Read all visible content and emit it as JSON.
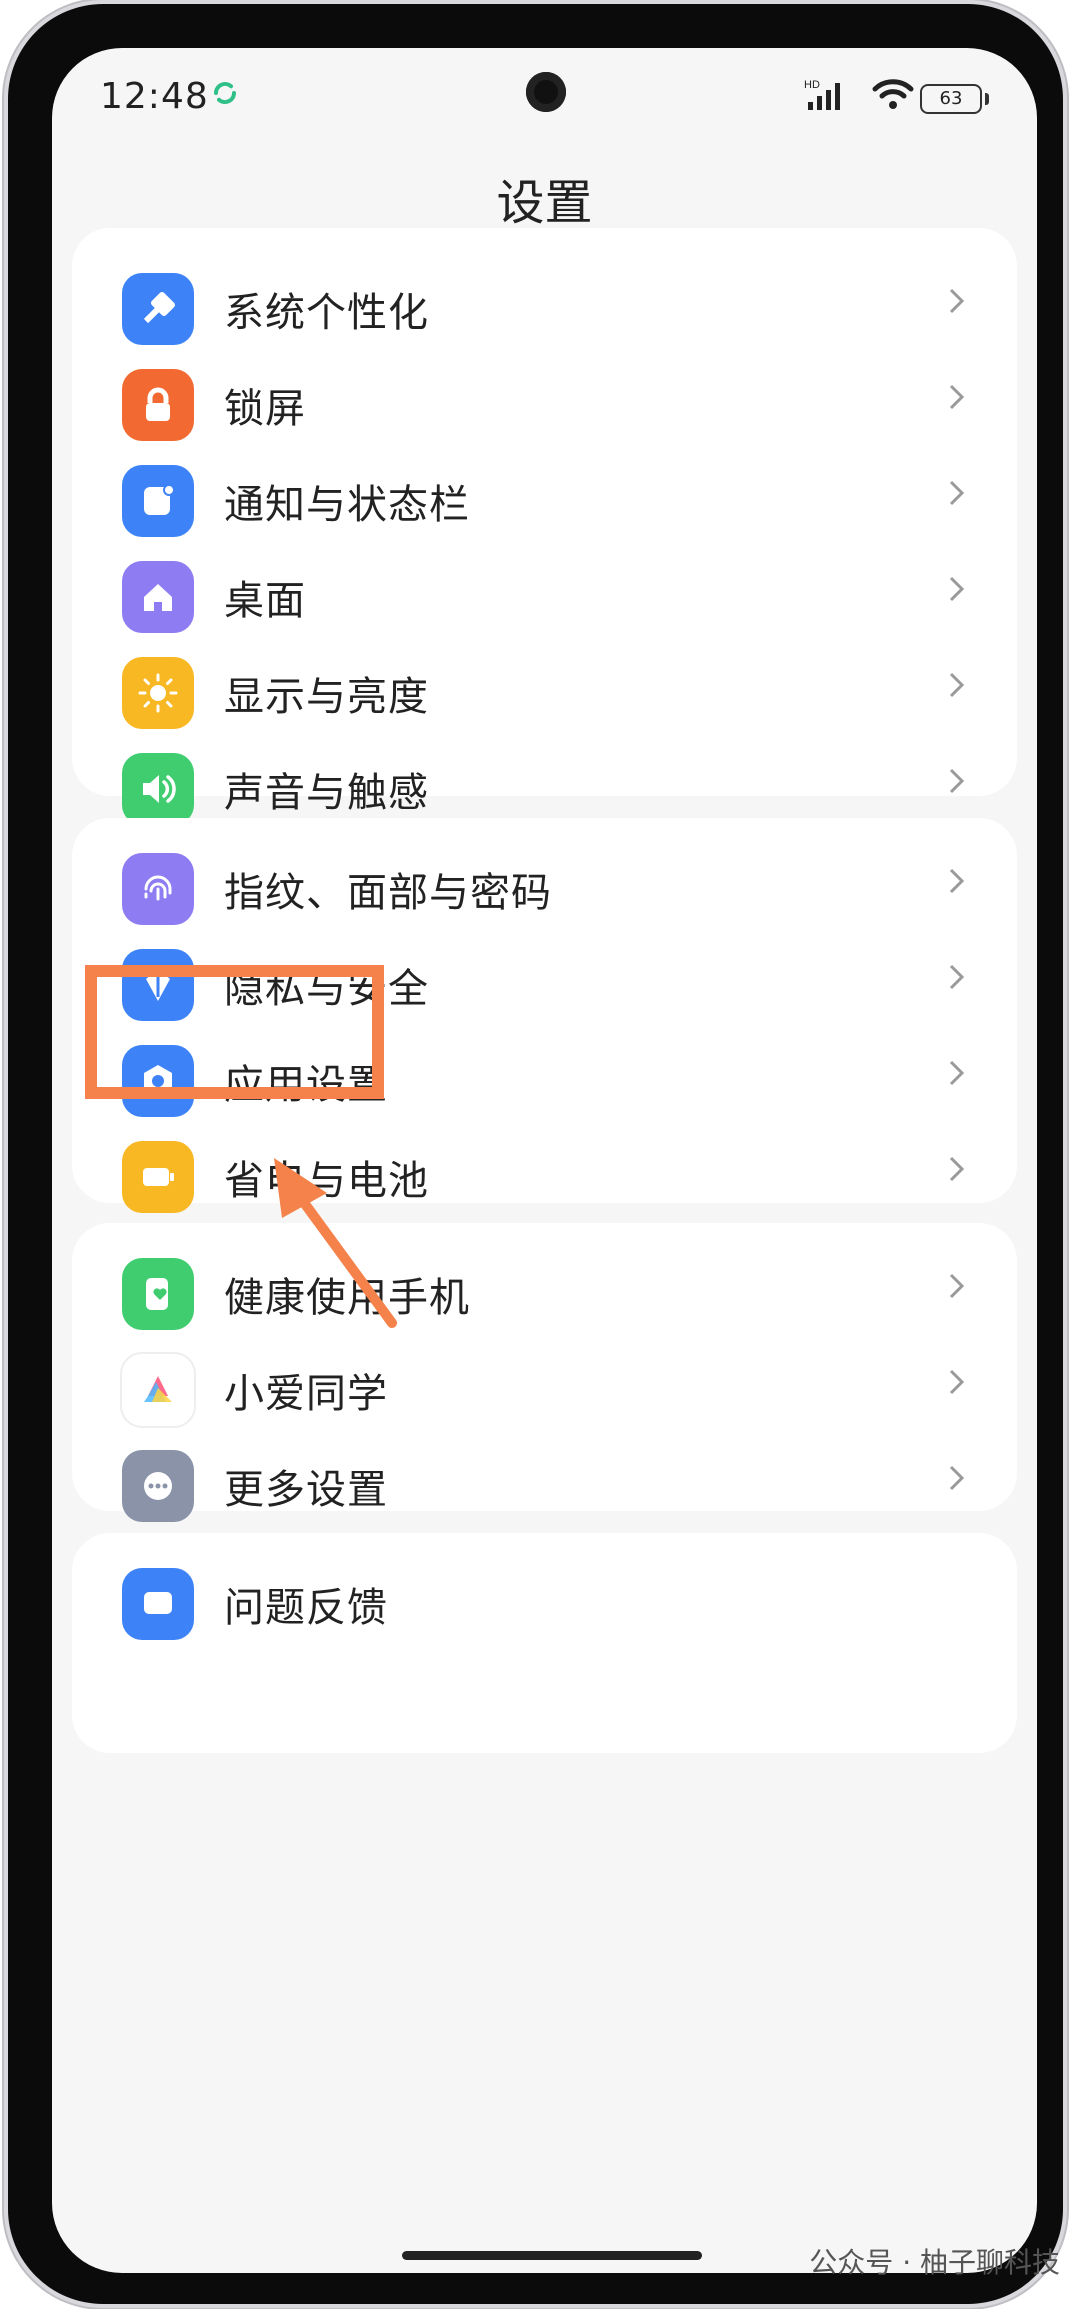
{
  "status": {
    "time": "12:48",
    "battery": "63",
    "network_badge": "HD"
  },
  "page": {
    "title": "设置"
  },
  "groups": [
    {
      "items": [
        {
          "label": "系统个性化",
          "icon": "brush-icon",
          "color": "#3d82f7"
        },
        {
          "label": "锁屏",
          "icon": "lock-icon",
          "color": "#f26a31"
        },
        {
          "label": "通知与状态栏",
          "icon": "notification-icon",
          "color": "#3d82f7"
        },
        {
          "label": "桌面",
          "icon": "home-icon",
          "color": "#8d7cf2"
        },
        {
          "label": "显示与亮度",
          "icon": "sun-icon",
          "color": "#f8b823"
        },
        {
          "label": "声音与触感",
          "icon": "speaker-icon",
          "color": "#3fcd70"
        }
      ]
    },
    {
      "items": [
        {
          "label": "指纹、面部与密码",
          "icon": "fingerprint-icon",
          "color": "#8d7cf2"
        },
        {
          "label": "隐私与安全",
          "icon": "privacy-icon",
          "color": "#3d82f7"
        },
        {
          "label": "应用设置",
          "icon": "app-settings-icon",
          "color": "#3d82f7"
        },
        {
          "label": "省电与电池",
          "icon": "battery-icon",
          "color": "#f8b823"
        }
      ]
    },
    {
      "items": [
        {
          "label": "健康使用手机",
          "icon": "health-icon",
          "color": "#3fcd70"
        },
        {
          "label": "小爱同学",
          "icon": "xiaoai-icon",
          "color": "#ffffff"
        },
        {
          "label": "更多设置",
          "icon": "more-icon",
          "color": "#8a93a8"
        }
      ]
    },
    {
      "items": [
        {
          "label": "问题反馈",
          "icon": "feedback-icon",
          "color": "#3d82f7"
        }
      ]
    }
  ],
  "annotation": {
    "highlight_color": "#f5824a"
  },
  "watermark": "公众号 · 柚子聊科技"
}
